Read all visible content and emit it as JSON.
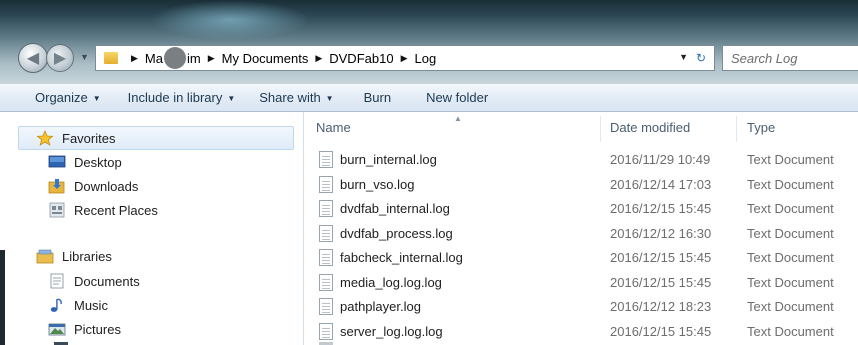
{
  "window": {
    "nav": {
      "back_icon": "back-arrow-icon",
      "forward_icon": "forward-arrow-icon"
    },
    "breadcrumb": {
      "items": [
        "Ma",
        "im",
        "My Documents",
        "DVDFab10",
        "Log"
      ]
    },
    "search": {
      "placeholder": "Search Log"
    }
  },
  "toolbar": {
    "organize": "Organize",
    "include_in_library": "Include in library",
    "share_with": "Share with",
    "burn": "Burn",
    "new_folder": "New folder"
  },
  "sidebar": {
    "favorites": "Favorites",
    "favorite_items": [
      {
        "label": "Desktop",
        "icon": "desktop-icon"
      },
      {
        "label": "Downloads",
        "icon": "downloads-icon"
      },
      {
        "label": "Recent Places",
        "icon": "recent-places-icon"
      }
    ],
    "libraries": "Libraries",
    "library_items": [
      {
        "label": "Documents",
        "icon": "documents-icon"
      },
      {
        "label": "Music",
        "icon": "music-icon"
      },
      {
        "label": "Pictures",
        "icon": "pictures-icon"
      }
    ]
  },
  "columns": {
    "name": "Name",
    "date_modified": "Date modified",
    "type": "Type"
  },
  "files": [
    {
      "name": "burn_internal.log",
      "date": "2016/11/29 10:49",
      "type": "Text Document"
    },
    {
      "name": "burn_vso.log",
      "date": "2016/12/14 17:03",
      "type": "Text Document"
    },
    {
      "name": "dvdfab_internal.log",
      "date": "2016/12/15 15:45",
      "type": "Text Document"
    },
    {
      "name": "dvdfab_process.log",
      "date": "2016/12/12 16:30",
      "type": "Text Document"
    },
    {
      "name": "fabcheck_internal.log",
      "date": "2016/12/15 15:45",
      "type": "Text Document"
    },
    {
      "name": "media_log.log.log",
      "date": "2016/12/15 15:45",
      "type": "Text Document"
    },
    {
      "name": "pathplayer.log",
      "date": "2016/12/12 18:23",
      "type": "Text Document"
    },
    {
      "name": "server_log.log.log",
      "date": "2016/12/15 15:45",
      "type": "Text Document"
    }
  ],
  "colors": {
    "accent": "#1e3950",
    "selection": "#dfebf8"
  }
}
